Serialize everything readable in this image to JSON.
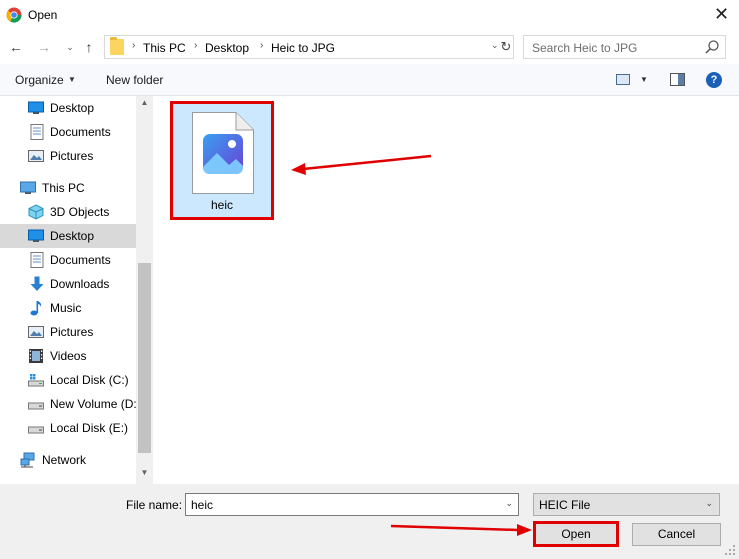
{
  "window": {
    "title": "Open",
    "close_glyph": "✕"
  },
  "nav": {
    "back_glyph": "←",
    "forward_glyph": "→",
    "recent_glyph": "⌄",
    "up_glyph": "↑"
  },
  "address": {
    "crumbs": [
      "This PC",
      "Desktop",
      "Heic to JPG"
    ],
    "separator": "›",
    "dropdown_glyph": "⌄",
    "refresh_glyph": "↻"
  },
  "search": {
    "placeholder": "Search Heic to JPG"
  },
  "toolbar": {
    "organize_label": "Organize",
    "organize_arrow": "▼",
    "new_folder_label": "New folder",
    "view_dropdown_glyph": "▼",
    "help_glyph": "?"
  },
  "sidebar": {
    "items": [
      {
        "label": "Desktop",
        "icon": "desktop-icon"
      },
      {
        "label": "Documents",
        "icon": "documents-icon"
      },
      {
        "label": "Pictures",
        "icon": "pictures-icon"
      },
      {
        "label": "This PC",
        "icon": "this-pc-icon"
      },
      {
        "label": "3D Objects",
        "icon": "3d-objects-icon"
      },
      {
        "label": "Desktop",
        "icon": "desktop-icon",
        "selected": true
      },
      {
        "label": "Documents",
        "icon": "documents-icon"
      },
      {
        "label": "Downloads",
        "icon": "downloads-icon"
      },
      {
        "label": "Music",
        "icon": "music-icon"
      },
      {
        "label": "Pictures",
        "icon": "pictures-icon"
      },
      {
        "label": "Videos",
        "icon": "videos-icon"
      },
      {
        "label": "Local Disk (C:)",
        "icon": "drive-c-icon"
      },
      {
        "label": "New Volume (D:",
        "icon": "drive-icon"
      },
      {
        "label": "Local Disk (E:)",
        "icon": "drive-icon"
      },
      {
        "label": "Network",
        "icon": "network-icon"
      }
    ],
    "scroll_up_glyph": "▲",
    "scroll_down_glyph": "▼"
  },
  "files": [
    {
      "name": "heic",
      "selected": true,
      "icon": "image-file-icon"
    }
  ],
  "footer": {
    "file_name_label": "File name:",
    "file_name_value": "heic",
    "file_name_dropdown_glyph": "⌄",
    "file_type_value": "HEIC File",
    "file_type_dropdown_glyph": "⌄",
    "open_label": "Open",
    "cancel_label": "Cancel"
  },
  "colors": {
    "highlight_red": "#e00000",
    "selection_blue": "#cce8ff",
    "accent_blue": "#1b5fb8"
  }
}
